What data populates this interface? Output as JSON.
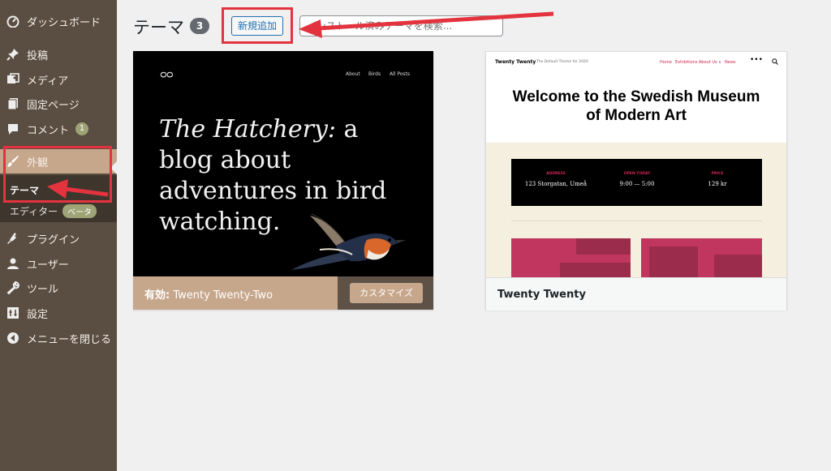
{
  "sidebar": {
    "items": [
      {
        "label": "ダッシュボード",
        "icon": "dashboard-icon"
      },
      {
        "label": "投稿",
        "icon": "pushpin-icon"
      },
      {
        "label": "メディア",
        "icon": "media-icon"
      },
      {
        "label": "固定ページ",
        "icon": "pages-icon"
      },
      {
        "label": "コメント",
        "icon": "comment-icon",
        "badge": "1"
      },
      {
        "label": "外観",
        "icon": "brush-icon"
      },
      {
        "label": "プラグイン",
        "icon": "plugin-icon"
      },
      {
        "label": "ユーザー",
        "icon": "user-icon"
      },
      {
        "label": "ツール",
        "icon": "wrench-icon"
      },
      {
        "label": "設定",
        "icon": "settings-icon"
      },
      {
        "label": "メニューを閉じる",
        "icon": "collapse-icon"
      }
    ],
    "submenu": {
      "themes": "テーマ",
      "editor": "エディター",
      "beta": "ベータ"
    }
  },
  "header": {
    "title": "テーマ",
    "count": "3",
    "add_new": "新規追加",
    "search_placeholder": "インストール済みテーマを検索..."
  },
  "themes": [
    {
      "name": "Twenty Twenty-Two",
      "active_label": "有効:",
      "customize": "カスタマイズ",
      "preview": {
        "logo": "ᴑᴑ",
        "nav": [
          "About",
          "Birds",
          "All Posts"
        ],
        "headline_italic": "The Hatchery:",
        "headline_rest": " a blog about adventures in bird watching."
      }
    },
    {
      "name": "Twenty Twenty",
      "preview": {
        "site": "Twenty Twenty",
        "tagline": "The Default Theme for 2020",
        "nav": [
          "Home",
          "Exhibitions",
          "About Us ∨",
          "News"
        ],
        "title": "Welcome to the Swedish Museum of Modern Art",
        "info": [
          {
            "label": "ADDRESS",
            "value": "123 Storgatan, Umeå"
          },
          {
            "label": "OPEN TODAY",
            "value": "9:00 — 5:00"
          },
          {
            "label": "PRICE",
            "value": "129 kr"
          }
        ]
      }
    }
  ],
  "colors": {
    "sidebar": "#5a4d41",
    "accent": "#c7a78c",
    "annotation": "#e3333f",
    "link": "#2271b1"
  }
}
